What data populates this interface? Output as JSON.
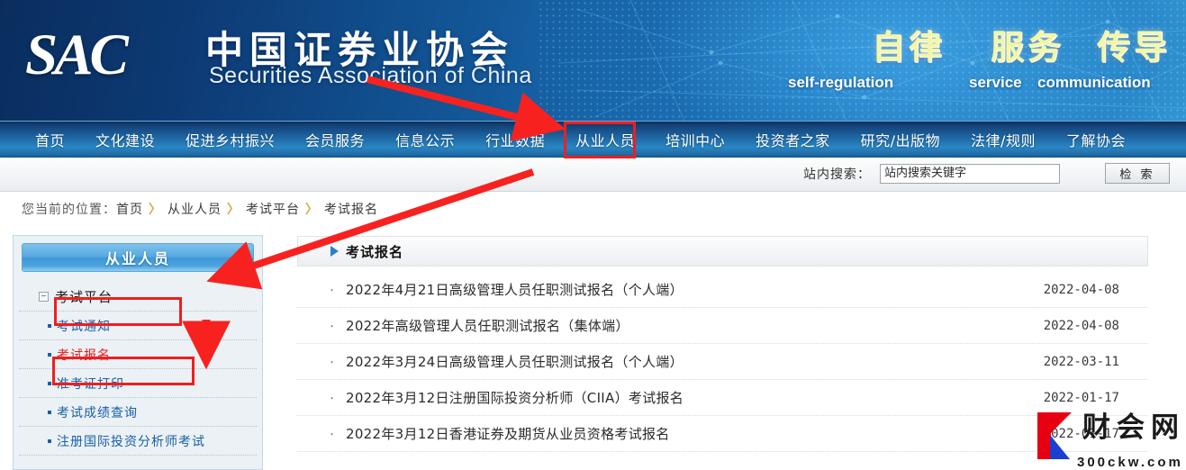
{
  "banner": {
    "logo_text": "SAC",
    "brand_cn": "中国证券业协会",
    "brand_en": "Securities Association of China",
    "slogans": [
      {
        "cn": "自律",
        "en": "self-regulation"
      },
      {
        "cn": "服务",
        "en": "service"
      },
      {
        "cn": "传导",
        "en": "communication"
      }
    ]
  },
  "nav": {
    "items": [
      {
        "label": "首页"
      },
      {
        "label": "文化建设"
      },
      {
        "label": "促进乡村振兴"
      },
      {
        "label": "会员服务"
      },
      {
        "label": "信息公示"
      },
      {
        "label": "行业数据"
      },
      {
        "label": "从业人员"
      },
      {
        "label": "培训中心"
      },
      {
        "label": "投资者之家"
      },
      {
        "label": "研究/出版物"
      },
      {
        "label": "法律/规则"
      },
      {
        "label": "了解协会"
      }
    ],
    "highlighted": "从业人员"
  },
  "search": {
    "label": "站内搜索：",
    "placeholder": "站内搜索关键字",
    "value": "",
    "button": "检 索"
  },
  "breadcrumb": {
    "prefix": "您当前的位置：",
    "items": [
      "首页",
      "从业人员",
      "考试平台",
      "考试报名"
    ],
    "separator": "〉"
  },
  "sidebar": {
    "title": "从业人员",
    "items": [
      {
        "label": "考试平台",
        "type": "parent",
        "expand_icon": "−",
        "highlighted": true
      },
      {
        "label": "考试通知",
        "type": "child"
      },
      {
        "label": "考试报名",
        "type": "child",
        "active": true,
        "highlighted": true
      },
      {
        "label": "准考证打印",
        "type": "child"
      },
      {
        "label": "考试成绩查询",
        "type": "child"
      },
      {
        "label": "注册国际投资分析师考试",
        "type": "child"
      }
    ]
  },
  "main": {
    "panel_title": "考试报名",
    "bullet": "·",
    "rows": [
      {
        "title": "2022年4月21日高级管理人员任职测试报名（个人端）",
        "date": "2022-04-08"
      },
      {
        "title": "2022年高级管理人员任职测试报名（集体端）",
        "date": "2022-04-08"
      },
      {
        "title": "2022年3月24日高级管理人员任职测试报名（个人端）",
        "date": "2022-03-11"
      },
      {
        "title": "2022年3月12日注册国际投资分析师（CIIA）考试报名",
        "date": "2022-01-17"
      },
      {
        "title": "2022年3月12日香港证券及期货从业员资格考试报名",
        "date": "2022-01-17"
      }
    ]
  },
  "watermark": {
    "logo": "K",
    "name": "财会网",
    "url": "300ckw.com"
  },
  "colors": {
    "banner_dark": "#0a2d5e",
    "banner_light": "#3aa6e0",
    "nav_blue": "#2a86c4",
    "annotation_red": "#f01e1e",
    "link_blue": "#1a5fa8",
    "active_red": "#e81d1d",
    "slogan_yellow": "#f2f7a8"
  }
}
